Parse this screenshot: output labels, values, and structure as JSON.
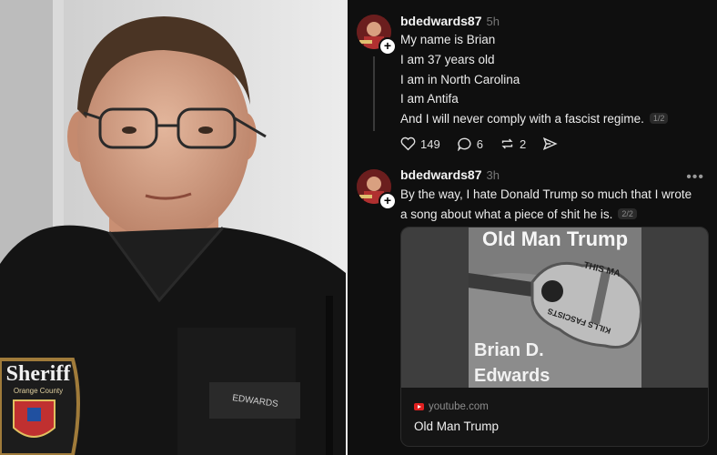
{
  "posts": [
    {
      "username": "bdedwards87",
      "time": "5h",
      "lines": [
        "My name is Brian",
        "I am 37 years old",
        "I am in North Carolina",
        "I am Antifa",
        "And I will never comply with a fascist regime."
      ],
      "pager": "1/2",
      "likes": "149",
      "comments": "6",
      "reposts": "2"
    },
    {
      "username": "bdedwards87",
      "time": "3h",
      "lines": [
        "By the way, I hate Donald Trump so much that I wrote",
        "a song about what a piece of shit he is."
      ],
      "pager": "2/2",
      "more": "•••",
      "link": {
        "cover_title": "Old Man Trump",
        "cover_artist_line1": "Brian D.",
        "cover_artist_line2": "Edwards",
        "guitar_text_top": "THIS MA",
        "guitar_text_bottom": "KILLS FASCISTS",
        "domain": "youtube.com",
        "title": "Old Man Trump"
      }
    }
  ],
  "photo": {
    "patch_text": "Sheriff",
    "patch_subtext": "Orange County",
    "badge_text": "EDWARDS"
  }
}
